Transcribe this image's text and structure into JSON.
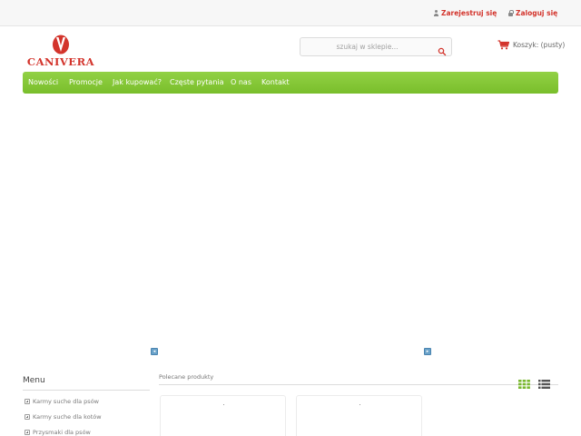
{
  "topbar": {
    "register_label": "Zarejestruj się",
    "login_label": "Zaloguj się"
  },
  "header": {
    "logo_text": "CANIVERA",
    "search_placeholder": "szukaj w sklepie...",
    "cart_label": "Koszyk: (pusty)"
  },
  "nav": {
    "items": [
      "Nowości",
      "Promocje",
      "Jak kupować?",
      "Częste pytania",
      "O nas",
      "Kontakt"
    ]
  },
  "sidebar": {
    "title": "Menu",
    "items": [
      "Karmy suche dla psów",
      "Karmy suche dla kotów",
      "Przysmaki dla psów"
    ]
  },
  "main": {
    "section_title": "Polecane produkty"
  },
  "colors": {
    "brand_red": "#d3342c",
    "nav_green": "#86c63a",
    "view_grid_green": "#7ab830",
    "view_list_dark": "#555555"
  },
  "icons": {
    "register": "person-icon",
    "login": "lock-icon",
    "search": "search-icon",
    "cart": "cart-icon",
    "menu_items": "plus-icon",
    "view_grid": "grid-view-icon",
    "view_list": "list-view-icon"
  }
}
